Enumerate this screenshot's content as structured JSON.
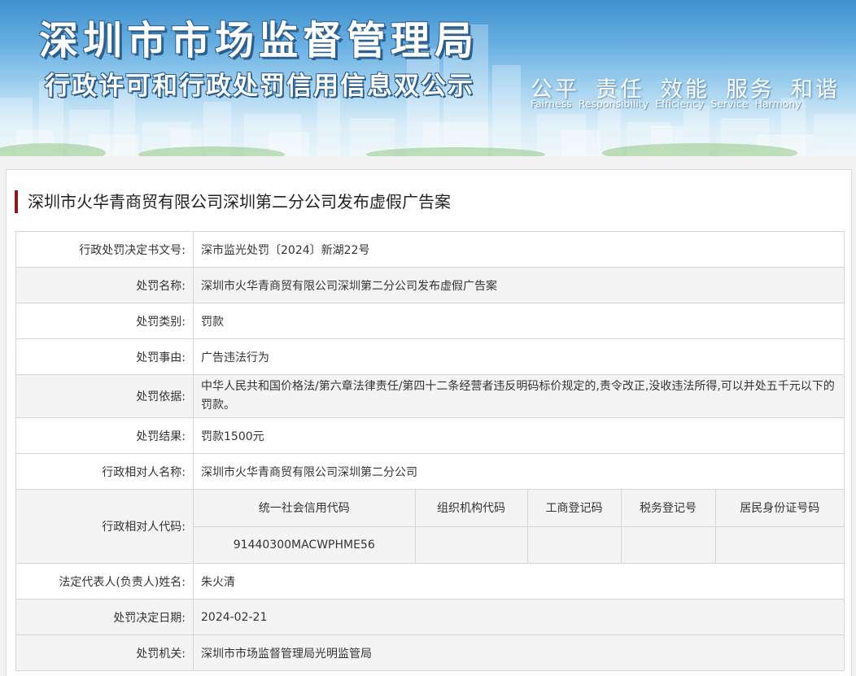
{
  "banner": {
    "title": "深圳市市场监督管理局",
    "subtitle": "行政许可和行政处罚信用信息双公示",
    "values_cn": [
      "公平",
      "责任",
      "效能",
      "服务",
      "和谐"
    ],
    "values_en": [
      "Fairness",
      "Responsibility",
      "Efficiency",
      "Service",
      "Harmony"
    ]
  },
  "case": {
    "title": "深圳市火华青商贸有限公司深圳第二分公司发布虚假广告案"
  },
  "rows": [
    {
      "label": "行政处罚决定书文号:",
      "value": "深市监光处罚〔2024〕新湖22号"
    },
    {
      "label": "处罚名称:",
      "value": "深圳市火华青商贸有限公司深圳第二分公司发布虚假广告案"
    },
    {
      "label": "处罚类别:",
      "value": "罚款"
    },
    {
      "label": "处罚事由:",
      "value": "广告违法行为"
    },
    {
      "label": "处罚依据:",
      "value": "中华人民共和国价格法/第六章法律责任/第四十二条经营者违反明码标价规定的,责令改正,没收违法所得,可以并处五千元以下的罚款。"
    },
    {
      "label": "处罚结果:",
      "value": "罚款1500元"
    },
    {
      "label": "行政相对人名称:",
      "value": "深圳市火华青商贸有限公司深圳第二分公司"
    }
  ],
  "codes": {
    "label": "行政相对人代码:",
    "headers": [
      "统一社会信用代码",
      "组织机构代码",
      "工商登记码",
      "税务登记号",
      "居民身份证号码"
    ],
    "values": [
      "91440300MACWPHME56",
      "",
      "",
      "",
      ""
    ]
  },
  "rows_after": [
    {
      "label": "法定代表人(负责人)姓名:",
      "value": "朱火清"
    },
    {
      "label": "处罚决定日期:",
      "value": "2024-02-21"
    },
    {
      "label": "处罚机关:",
      "value": "深圳市市场监督管理局光明监管局"
    }
  ]
}
